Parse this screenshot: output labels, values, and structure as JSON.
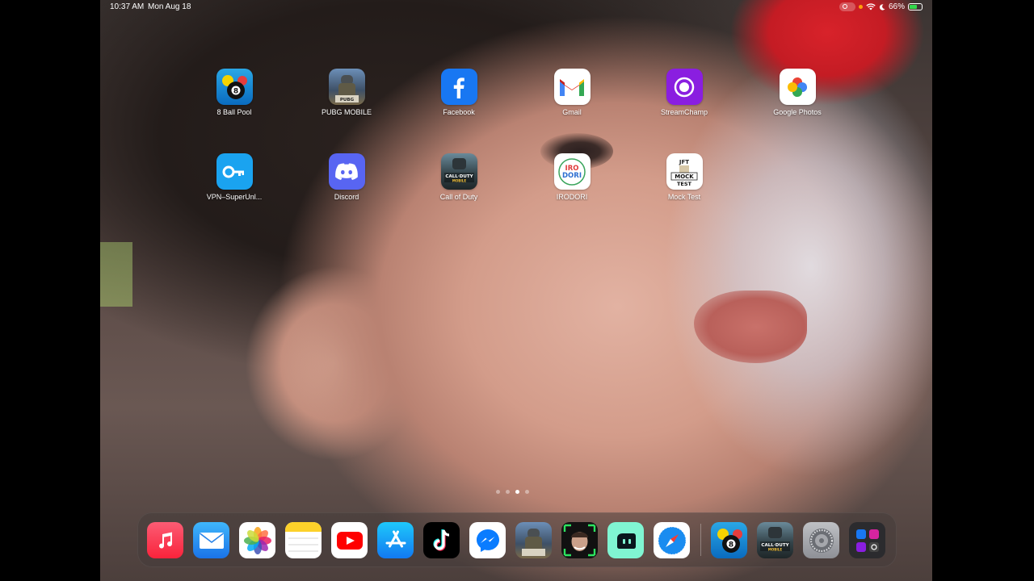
{
  "status_bar": {
    "time": "10:37 AM",
    "date": "Mon Aug 18",
    "battery_percent": "66%",
    "battery_level": 0.66,
    "icons": [
      "screen-recording-icon",
      "privacy-dot-icon",
      "wifi-icon",
      "moon-icon",
      "battery-charging-icon"
    ]
  },
  "apps": [
    {
      "name": "8 Ball Pool",
      "icon": "eight-ball-pool-icon"
    },
    {
      "name": "PUBG MOBILE",
      "icon": "pubg-mobile-icon"
    },
    {
      "name": "Facebook",
      "icon": "facebook-icon"
    },
    {
      "name": "Gmail",
      "icon": "gmail-icon"
    },
    {
      "name": "StreamChamp",
      "icon": "streamchamp-icon"
    },
    {
      "name": "Google Photos",
      "icon": "google-photos-icon"
    },
    {
      "name": "VPN–SuperUnl...",
      "icon": "vpn-key-icon"
    },
    {
      "name": "Discord",
      "icon": "discord-icon"
    },
    {
      "name": "Call of Duty",
      "icon": "call-of-duty-icon"
    },
    {
      "name": "IRODORI",
      "icon": "irodori-icon",
      "icon_text": "IRO DORI"
    },
    {
      "name": "Mock Test",
      "icon": "mock-test-icon",
      "icon_text": "JFT MOCK TEST"
    }
  ],
  "page_indicator": {
    "pages": 4,
    "current": 3
  },
  "dock": {
    "apps": [
      {
        "name": "Music",
        "icon": "music-icon"
      },
      {
        "name": "Mail",
        "icon": "mail-icon"
      },
      {
        "name": "Photos",
        "icon": "photos-icon"
      },
      {
        "name": "Notes",
        "icon": "notes-icon"
      },
      {
        "name": "YouTube",
        "icon": "youtube-icon"
      },
      {
        "name": "App Store",
        "icon": "app-store-icon"
      },
      {
        "name": "TikTok",
        "icon": "tiktok-icon"
      },
      {
        "name": "Messenger",
        "icon": "messenger-icon"
      },
      {
        "name": "PUBG MOBILE",
        "icon": "pubg-mobile-icon"
      },
      {
        "name": "Video app",
        "icon": "face-video-icon"
      },
      {
        "name": "Streamlabs",
        "icon": "streamlabs-icon"
      },
      {
        "name": "Safari",
        "icon": "safari-icon"
      }
    ],
    "recent_apps": [
      {
        "name": "8 Ball Pool",
        "icon": "eight-ball-pool-icon"
      },
      {
        "name": "Call of Duty",
        "icon": "call-of-duty-icon"
      },
      {
        "name": "Settings",
        "icon": "settings-icon"
      },
      {
        "name": "App Library",
        "icon": "app-library-icon"
      }
    ]
  },
  "colors": {
    "accent_green": "#32d74b",
    "wallpaper_red": "#d8222a"
  }
}
